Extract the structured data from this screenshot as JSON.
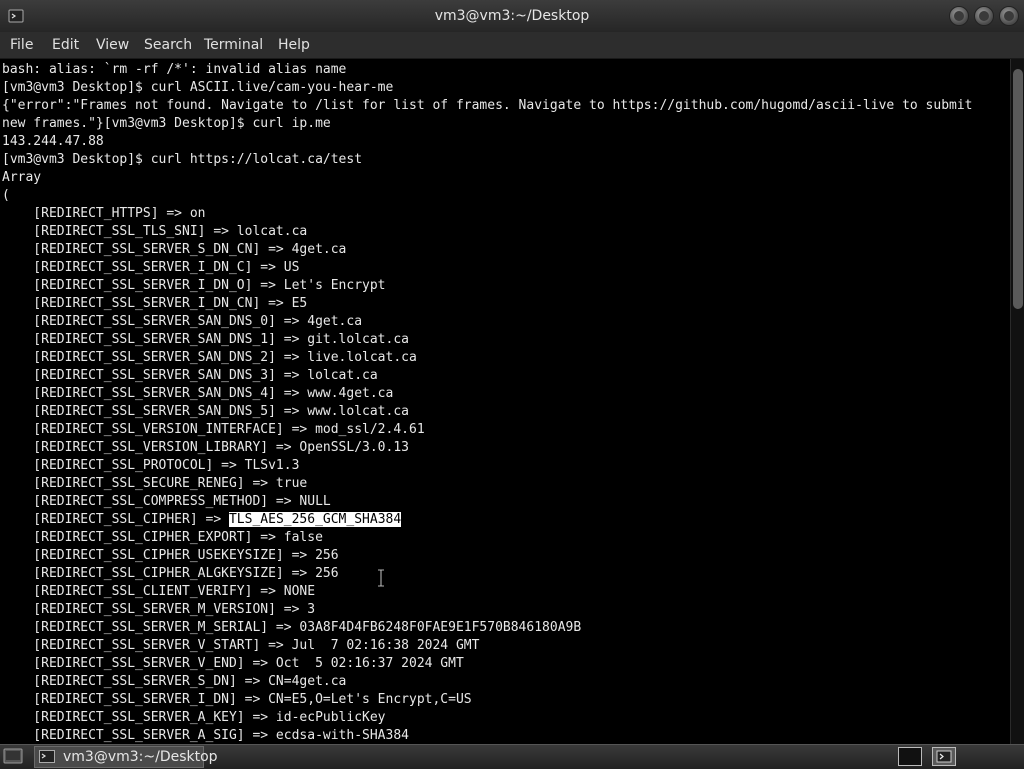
{
  "window": {
    "title": "vm3@vm3:~/Desktop"
  },
  "menu": [
    "File",
    "Edit",
    "View",
    "Search",
    "Terminal",
    "Help"
  ],
  "terminal": {
    "lines": [
      "bash: alias: `rm -rf /*': invalid alias name",
      "[vm3@vm3 Desktop]$ curl ASCII.live/cam-you-hear-me",
      "{\"error\":\"Frames not found. Navigate to /list for list of frames. Navigate to https://github.com/hugomd/ascii-live to submit",
      "new frames.\"}[vm3@vm3 Desktop]$ curl ip.me",
      "143.244.47.88",
      "[vm3@vm3 Desktop]$ curl https://lolcat.ca/test",
      "Array",
      "(",
      "    [REDIRECT_HTTPS] => on",
      "    [REDIRECT_SSL_TLS_SNI] => lolcat.ca",
      "    [REDIRECT_SSL_SERVER_S_DN_CN] => 4get.ca",
      "    [REDIRECT_SSL_SERVER_I_DN_C] => US",
      "    [REDIRECT_SSL_SERVER_I_DN_O] => Let's Encrypt",
      "    [REDIRECT_SSL_SERVER_I_DN_CN] => E5",
      "    [REDIRECT_SSL_SERVER_SAN_DNS_0] => 4get.ca",
      "    [REDIRECT_SSL_SERVER_SAN_DNS_1] => git.lolcat.ca",
      "    [REDIRECT_SSL_SERVER_SAN_DNS_2] => live.lolcat.ca",
      "    [REDIRECT_SSL_SERVER_SAN_DNS_3] => lolcat.ca",
      "    [REDIRECT_SSL_SERVER_SAN_DNS_4] => www.4get.ca",
      "    [REDIRECT_SSL_SERVER_SAN_DNS_5] => www.lolcat.ca",
      "    [REDIRECT_SSL_VERSION_INTERFACE] => mod_ssl/2.4.61",
      "    [REDIRECT_SSL_VERSION_LIBRARY] => OpenSSL/3.0.13",
      "    [REDIRECT_SSL_PROTOCOL] => TLSv1.3",
      "    [REDIRECT_SSL_SECURE_RENEG] => true",
      "    [REDIRECT_SSL_COMPRESS_METHOD] => NULL",
      "    [REDIRECT_SSL_CIPHER] => ",
      "    [REDIRECT_SSL_CIPHER_EXPORT] => false",
      "    [REDIRECT_SSL_CIPHER_USEKEYSIZE] => 256",
      "    [REDIRECT_SSL_CIPHER_ALGKEYSIZE] => 256",
      "    [REDIRECT_SSL_CLIENT_VERIFY] => NONE",
      "    [REDIRECT_SSL_SERVER_M_VERSION] => 3",
      "    [REDIRECT_SSL_SERVER_M_SERIAL] => 03A8F4D4FB6248F0FAE9E1F570B846180A9B",
      "    [REDIRECT_SSL_SERVER_V_START] => Jul  7 02:16:38 2024 GMT",
      "    [REDIRECT_SSL_SERVER_V_END] => Oct  5 02:16:37 2024 GMT",
      "    [REDIRECT_SSL_SERVER_S_DN] => CN=4get.ca",
      "    [REDIRECT_SSL_SERVER_I_DN] => CN=E5,O=Let's Encrypt,C=US",
      "    [REDIRECT_SSL_SERVER_A_KEY] => id-ecPublicKey",
      "    [REDIRECT_SSL_SERVER_A_SIG] => ecdsa-with-SHA384"
    ],
    "selected_text": "TLS_AES_256_GCM_SHA384"
  },
  "taskbar": {
    "task_label": "vm3@vm3:~/Desktop"
  },
  "colors": {
    "terminal_bg": "#000000",
    "terminal_fg": "#e8e8e8",
    "selection_bg": "#ffffff",
    "selection_fg": "#000000"
  }
}
